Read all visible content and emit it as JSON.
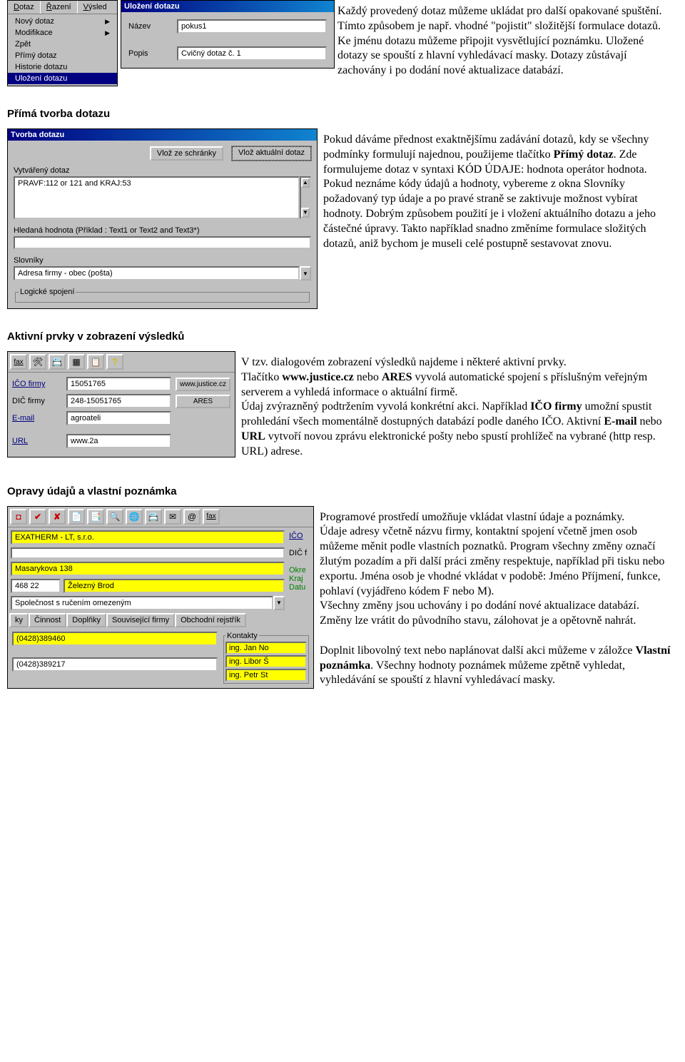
{
  "s1": {
    "menu_top": [
      "Dotaz",
      "Řazení",
      "Výsled"
    ],
    "sub": [
      "Nový dotaz",
      "Modifikace",
      "Zpět",
      "Přímý dotaz",
      "Historie dotazu",
      "Uložení dotazu"
    ],
    "dialog_title": "Uložení dotazu",
    "row1_lbl": "Název",
    "row1_val": "pokus1",
    "row2_lbl": "Popis",
    "row2_val": "Cvičný dotaz č. 1",
    "text": "Každý provedený dotaz můžeme ukládat pro další opakované spuštění. Tímto způsobem je např. vhodné \"pojistit\" složitější formulace dotazů. Ke jménu dotazu můžeme připojit vysvětlující poznámku. Uložené dotazy se spouští z hlavní vyhledávací masky. Dotazy zůstávají zachovány i po dodání nové aktualizace databází."
  },
  "s2": {
    "heading": "Přímá tvorba dotazu",
    "dialog_title": "Tvorba dotazu",
    "btn1": "Vlož ze schránky",
    "btn2": "Vlož aktuální dotaz",
    "lbl_vyt": "Vytvářený dotaz",
    "val_vyt": "PRAVF:112 or 121 and KRAJ:53",
    "lbl_hled": "Hledaná hodnota (Příklad :  Text1 or Text2 and Text3*)",
    "lbl_slov": "Slovníky",
    "val_slov": "Adresa firmy - obec (pošta)",
    "lbl_log": "Logické spojení",
    "text_a": "Pokud dáváme přednost exaktnějšímu zadávání dotazů, kdy se všechny podmínky formulují najednou, použijeme tlačítko ",
    "text_a_bold": "Přímý dotaz",
    "text_a2": ". Zde formulujeme dotaz v syntaxi KÓD ÚDAJE: hodnota operátor hodnota. Pokud neznáme kódy údajů a hodnoty, vybereme z okna Slovníky požadovaný typ údaje a po pravé straně se zaktivuje možnost vybírat hodnoty. Dobrým způsobem použití je i vložení aktuálního dotazu a jeho částečné úpravy. Takto například snadno změníme formulace složitých dotazů, aniž bychom je museli celé postupně sestavovat znovu."
  },
  "s3": {
    "heading": "Aktivní prvky v zobrazení výsledků",
    "ico_link": "IČO firmy",
    "dic_label": "DIČ firmy",
    "email_link": "E-mail",
    "url_link": "URL",
    "ico_val": "15051765",
    "justice_btn": "www.justice.cz",
    "dic_val": "248-15051765",
    "ares_btn": "ARES",
    "email_val": "agroateli",
    "url_val": "www.2a",
    "text_a": "V tzv. dialogovém zobrazení výsledků najdeme i některé aktivní prvky.",
    "text_b1": "Tlačítko ",
    "text_b_bold1": "www.justice.cz",
    "text_b2": " nebo ",
    "text_b_bold2": "ARES",
    "text_b3": " vyvolá automatické spojení s příslušným veřejným serverem a vyhledá informace o aktuální firmě.",
    "text_c": "Údaj zvýrazněný podtržením vyvolá konkrétní akci. Například ",
    "text_c_bold": "IČO firmy",
    "text_c2": " umožní spustit prohledání všech momentálně dostupných databází podle daného IČO. Aktivní ",
    "text_c_bold2": "E-mail",
    "text_c3": " nebo ",
    "text_c_bold3": "URL",
    "text_c4": " vytvoří novou zprávu elektronické pošty nebo spustí prohlížeč na vybrané (http resp. URL) adrese."
  },
  "s4": {
    "heading": "Opravy údajů a vlastní poznámka",
    "firma": "EXATHERM - LT, s.r.o.",
    "ulice": "Masarykova 138",
    "psc": "468 22",
    "mesto": "Železný Brod",
    "forma": "Společnost s ručením omezeným",
    "side_labels": [
      "IČO",
      "DIČ f",
      "Okre",
      "Kraj",
      "Datu"
    ],
    "tabs": [
      "ky",
      "Činnost",
      "Doplňky",
      "Související firmy",
      "Obchodní rejstřík"
    ],
    "tel1": "(0428)389460",
    "tel2": "(0428)389217",
    "kontakty_title": "Kontakty",
    "osoby": [
      "ing. Jan No",
      "ing. Libor Š",
      "ing. Petr St"
    ],
    "text_a": "Programové prostředí umožňuje vkládat vlastní údaje a poznámky.",
    "text_b": "Údaje adresy včetně názvu firmy, kontaktní spojení včetně jmen osob můžeme měnit podle vlastních poznatků. Program všechny změny označí žlutým pozadím a při další práci změny respektuje, například při tisku nebo exportu. Jména osob je vhodné vkládat v podobě: Jméno Příjmení, funkce, pohlaví (vyjádřeno kódem F nebo M).",
    "text_c": "Všechny změny jsou uchovány i po dodání nové aktualizace databází. Změny lze vrátit do původního stavu, zálohovat je a opětovně nahrát.",
    "text_d1": "Doplnit libovolný text nebo naplánovat další akci můžeme v záložce ",
    "text_d_bold": "Vlastní poznámka",
    "text_d2": ". Všechny hodnoty poznámek můžeme zpětně vyhledat, vyhledávání se spouští z hlavní vyhledávací masky."
  }
}
